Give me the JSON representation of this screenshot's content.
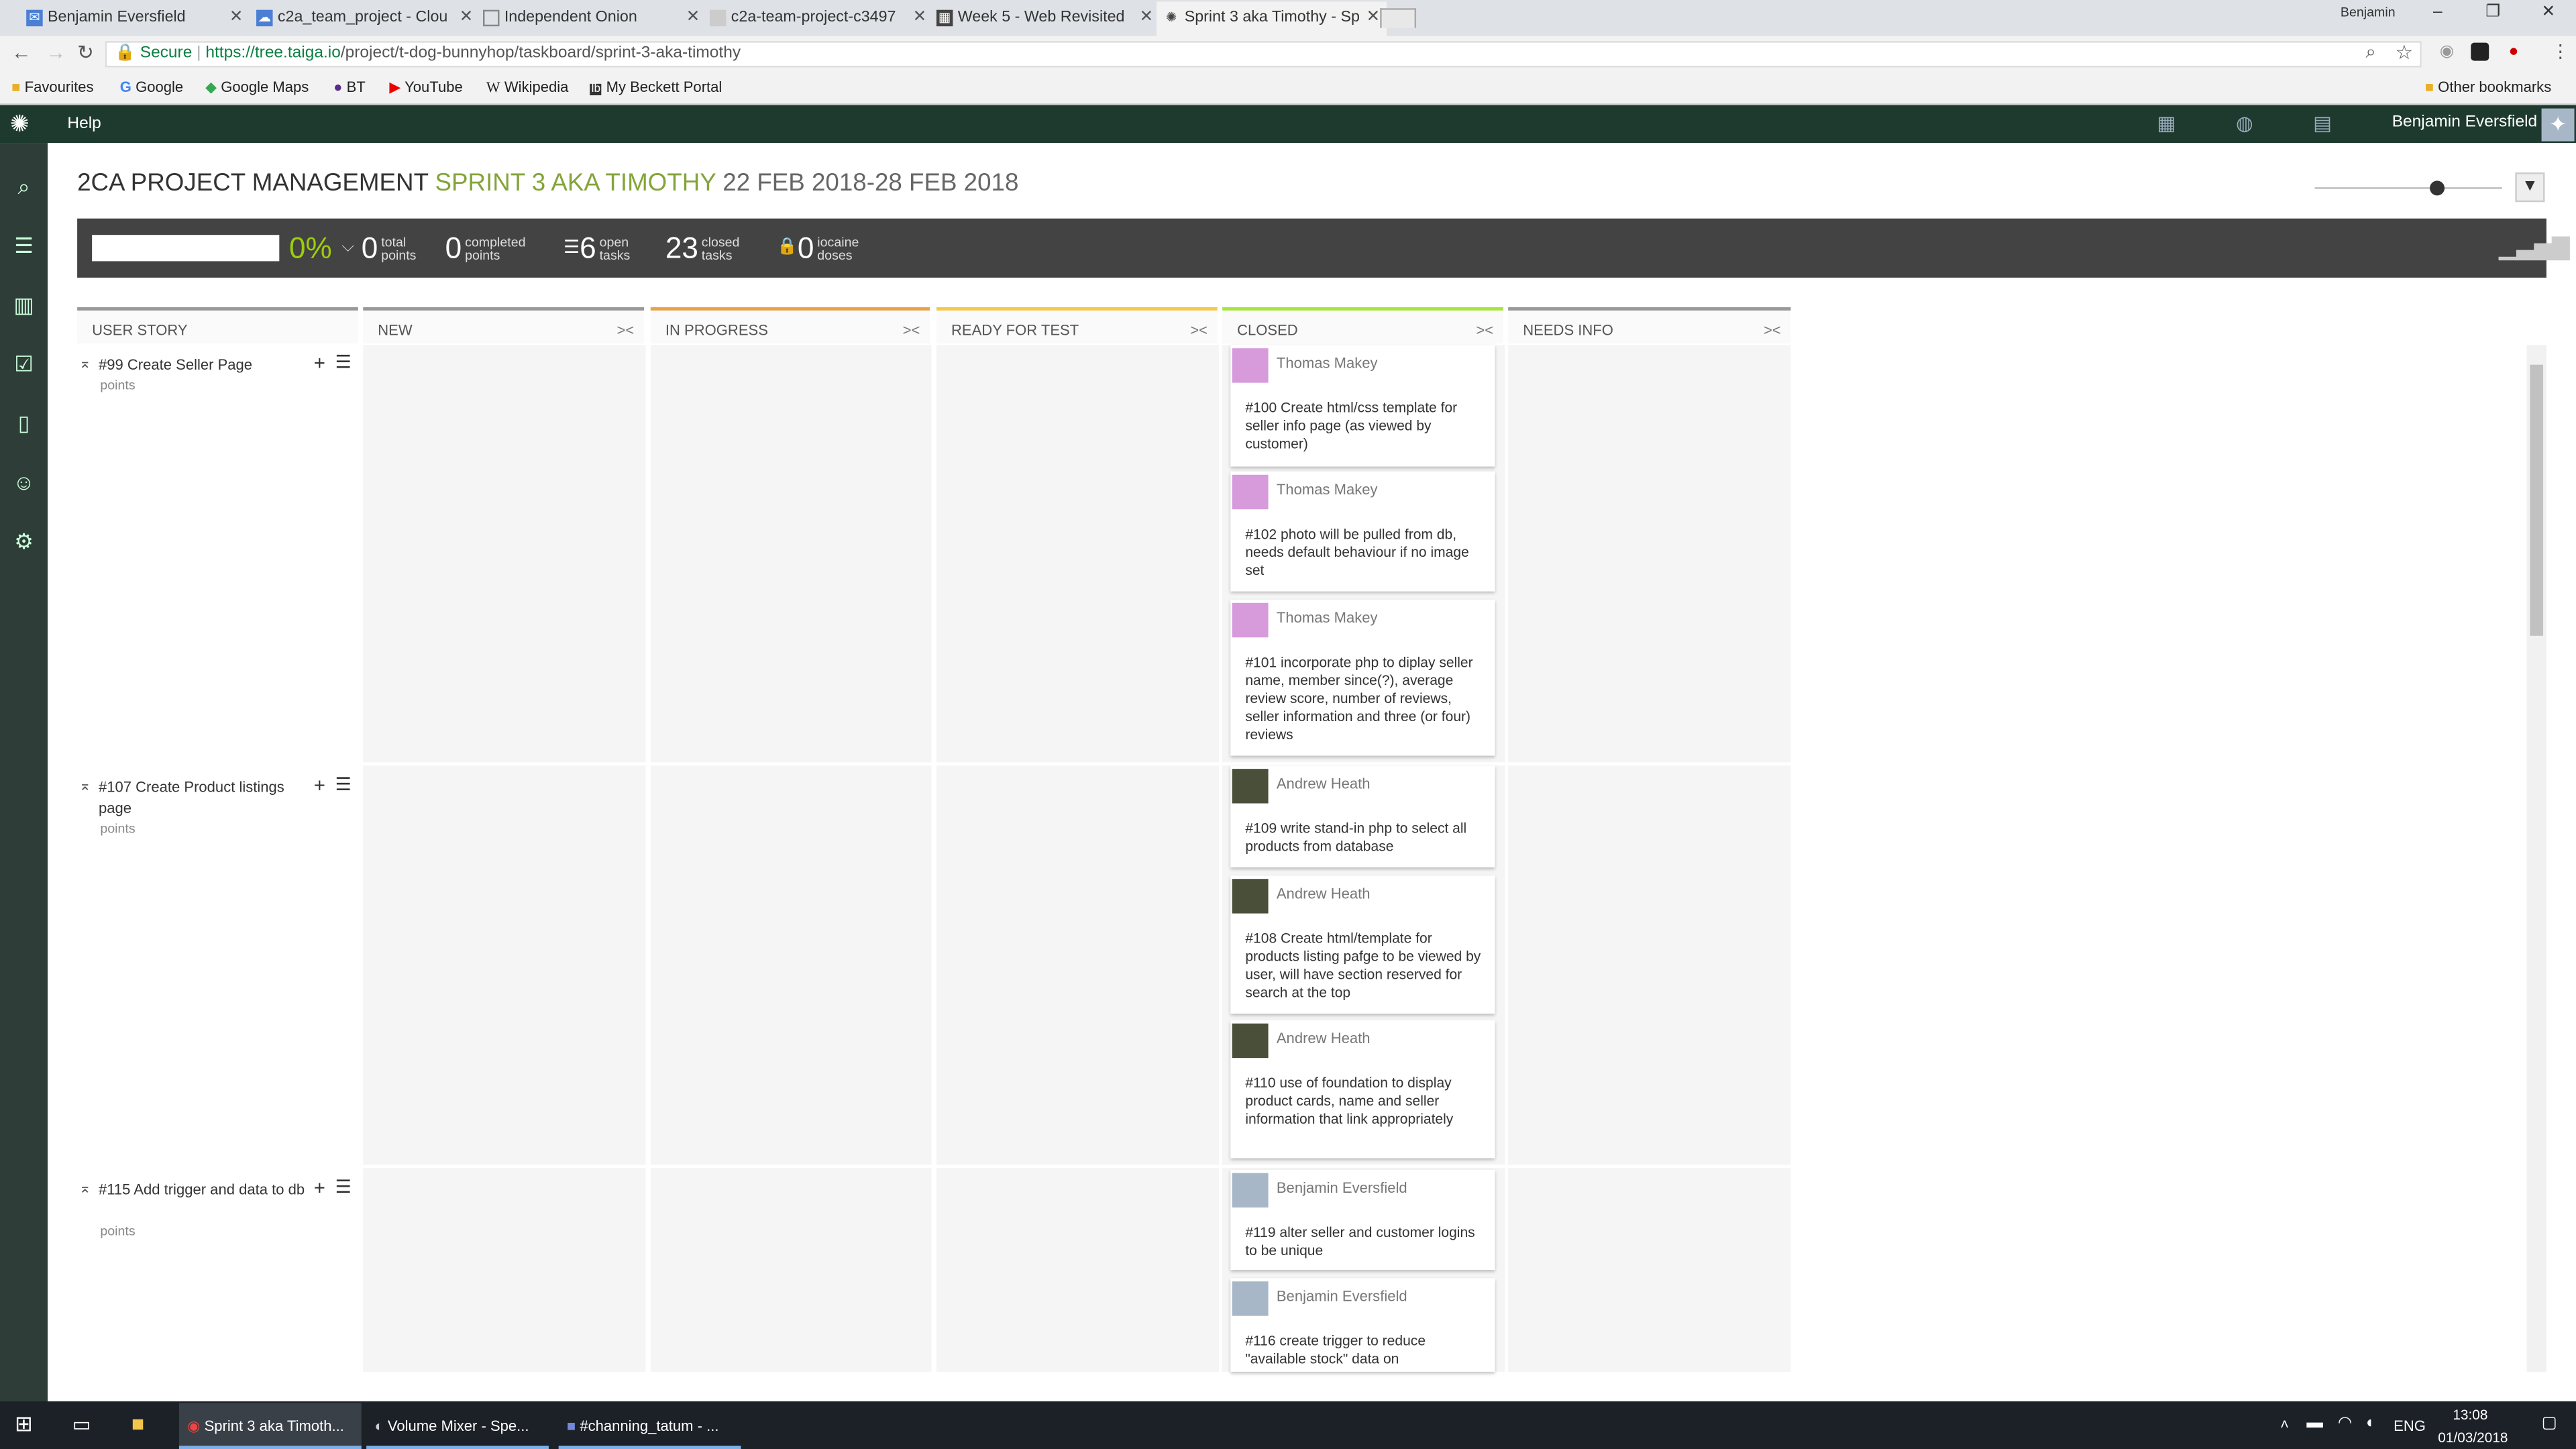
{
  "browser": {
    "tabs": [
      {
        "label": "Benjamin Eversfield",
        "icon": "mail-icon",
        "active": false
      },
      {
        "label": "c2a_team_project - Clou",
        "icon": "cloud-icon",
        "active": false
      },
      {
        "label": "Independent Onion",
        "icon": "page-icon",
        "active": false
      },
      {
        "label": "c2a-team-project-c3497",
        "icon": "folder-icon",
        "active": false
      },
      {
        "label": "Week 5 - Web Revisited",
        "icon": "board-icon",
        "active": false
      },
      {
        "label": "Sprint 3 aka Timothy - Sp",
        "icon": "taiga-icon",
        "active": true
      }
    ],
    "window_user": "Benjamin",
    "secure_label": "Secure",
    "url_host": "https://tree.taiga.io",
    "url_path": "/project/t-dog-bunnyhop/taskboard/sprint-3-aka-timothy",
    "bookmarks": [
      "Favourites",
      "Google",
      "Google Maps",
      "BT",
      "YouTube",
      "Wikipedia",
      "My Beckett Portal"
    ],
    "other_bookmarks": "Other bookmarks"
  },
  "topnav": {
    "help": "Help",
    "user_name": "Benjamin Eversfield"
  },
  "page": {
    "project": "2CA PROJECT MANAGEMENT",
    "sprint": "SPRINT 3 AKA TIMOTHY",
    "dates": "22 FEB 2018-28 FEB 2018"
  },
  "stats": {
    "percent": "0%",
    "total_points": "0",
    "total_label_1": "total",
    "total_label_2": "points",
    "completed_points": "0",
    "completed_label_1": "completed",
    "completed_label_2": "points",
    "open_tasks": "6",
    "open_label_1": "open",
    "open_label_2": "tasks",
    "closed_tasks": "23",
    "closed_label_1": "closed",
    "closed_label_2": "tasks",
    "iocaine": "0",
    "iocaine_label_1": "iocaine",
    "iocaine_label_2": "doses"
  },
  "columns": [
    {
      "label": "USER STORY",
      "color": "#999999"
    },
    {
      "label": "NEW",
      "color": "#999999"
    },
    {
      "label": "IN PROGRESS",
      "color": "#e8a24b"
    },
    {
      "label": "READY FOR TEST",
      "color": "#f5c84c"
    },
    {
      "label": "CLOSED",
      "color": "#a8e440"
    },
    {
      "label": "NEEDS INFO",
      "color": "#999999"
    }
  ],
  "stories": [
    {
      "title": "#99 Create Seller Page",
      "points": "points"
    },
    {
      "title": "#107 Create Product listings page",
      "points": "points"
    },
    {
      "title": "#115 Add trigger and data to db",
      "points": "points"
    }
  ],
  "cards": [
    {
      "assignee": "Thomas Makey",
      "desc": "#100 Create html/css template for seller info page (as viewed by customer)"
    },
    {
      "assignee": "Thomas Makey",
      "desc": "#102 photo will be pulled from db, needs default behaviour if no image set"
    },
    {
      "assignee": "Thomas Makey",
      "desc": "#101 incorporate php to diplay seller name, member since(?), average review score, number of reviews, seller information and three (or four) reviews"
    },
    {
      "assignee": "Andrew Heath",
      "desc": "#109 write stand-in php to select all products from database"
    },
    {
      "assignee": "Andrew Heath",
      "desc": "#108 Create html/template for products listing pafge to be viewed by user, will have section reserved for search at the top"
    },
    {
      "assignee": "Andrew Heath",
      "desc": "#110 use of foundation to display product cards, name and seller information that link appropriately"
    },
    {
      "assignee": "Benjamin Eversfield",
      "desc": "#119 alter seller and customer logins to be unique"
    },
    {
      "assignee": "Benjamin Eversfield",
      "desc": "#116 create trigger to reduce \"available stock\" data on"
    }
  ],
  "taskbar": {
    "items": [
      "Sprint 3 aka Timoth...",
      "Volume Mixer - Spe...",
      "#channing_tatum - ..."
    ],
    "lang": "ENG",
    "time": "13:08",
    "date": "01/03/2018"
  }
}
